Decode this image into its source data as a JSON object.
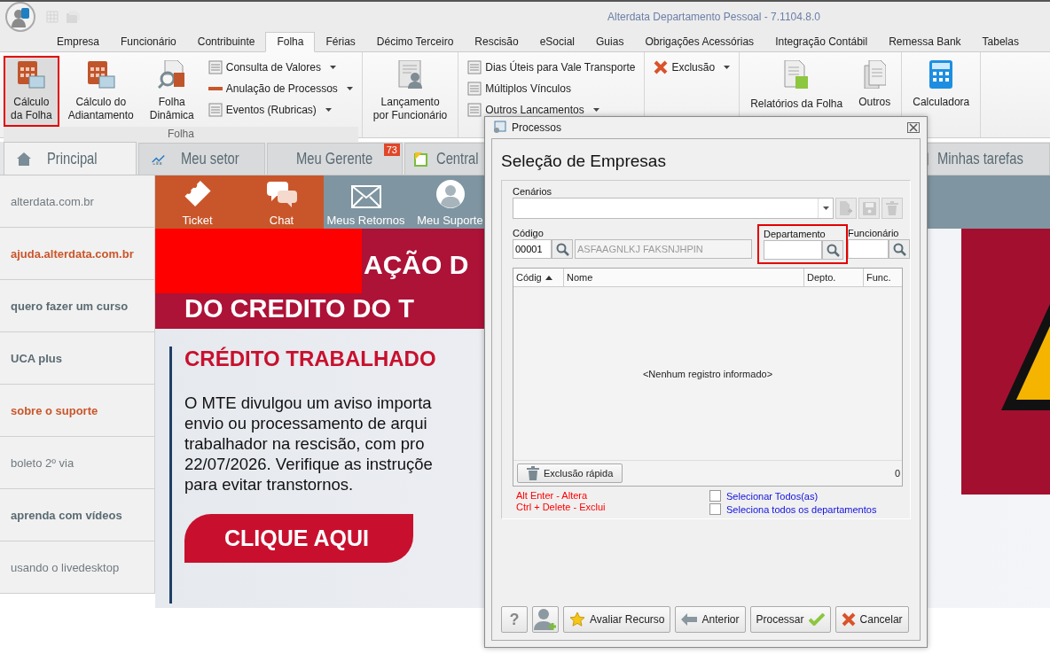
{
  "window": {
    "title": "Alterdata Departamento Pessoal - 7.1104.8.0"
  },
  "ribbon_tabs": [
    {
      "label": "Empresa",
      "selected": false
    },
    {
      "label": "Funcionário",
      "selected": false
    },
    {
      "label": "Contribuinte",
      "selected": false
    },
    {
      "label": "Folha",
      "selected": true
    },
    {
      "label": "Férias",
      "selected": false
    },
    {
      "label": "Décimo Terceiro",
      "selected": false
    },
    {
      "label": "Rescisão",
      "selected": false
    },
    {
      "label": "eSocial",
      "selected": false
    },
    {
      "label": "Guias",
      "selected": false
    },
    {
      "label": "Obrigações Acessórias",
      "selected": false
    },
    {
      "label": "Integração Contábil",
      "selected": false
    },
    {
      "label": "Remessa Bank",
      "selected": false
    },
    {
      "label": "Tabelas",
      "selected": false
    }
  ],
  "ribbon_groups": [
    {
      "label": "Folha",
      "items": [
        {
          "kind": "large",
          "lines": [
            "Cálculo",
            "da Folha"
          ],
          "highlighted": true
        },
        {
          "kind": "large",
          "lines": [
            "Cálculo do",
            "Adiantamento"
          ],
          "highlighted": false
        },
        {
          "kind": "large",
          "lines": [
            "Folha",
            "Dinâmica"
          ],
          "highlighted": false
        },
        {
          "kind": "list",
          "entries": [
            {
              "label": "Consulta de Valores",
              "dropdown": true
            },
            {
              "label": "Anulação de Processos",
              "dropdown": true
            },
            {
              "label": "Eventos (Rubricas)",
              "dropdown": true
            }
          ]
        }
      ]
    },
    {
      "items": [
        {
          "kind": "large",
          "lines": [
            "Lançamento",
            "por Funcionário"
          ],
          "highlighted": false
        }
      ]
    },
    {
      "items": [
        {
          "kind": "list",
          "entries": [
            {
              "label": "Dias Úteis para Vale Transporte",
              "dropdown": false
            },
            {
              "label": "Múltiplos Vínculos",
              "dropdown": false
            },
            {
              "label": "Outros Lancamentos",
              "dropdown": true
            }
          ]
        }
      ]
    },
    {
      "items": [
        {
          "kind": "list",
          "entries": [
            {
              "label": "Exclusão",
              "dropdown": true
            }
          ]
        }
      ]
    },
    {
      "items": [
        {
          "kind": "large",
          "lines": [
            "Relatórios da Folha"
          ],
          "highlighted": false
        },
        {
          "kind": "large",
          "lines": [
            "Outros"
          ],
          "highlighted": false
        }
      ]
    },
    {
      "items": [
        {
          "kind": "large",
          "lines": [
            "Calculadora"
          ],
          "highlighted": false
        }
      ]
    }
  ],
  "home_tabs": [
    {
      "label": "Principal",
      "selected": true
    },
    {
      "label": "Meu setor",
      "selected": false
    },
    {
      "label": "Meu Gerente",
      "selected": false,
      "badge": "73"
    },
    {
      "label": "Central",
      "selected": false
    },
    {
      "label": "Minhas tarefas",
      "selected": false
    }
  ],
  "sidebar": {
    "items": [
      {
        "label": "alterdata.com.br",
        "kind": "plain"
      },
      {
        "label": "ajuda.alterdata.com.br",
        "kind": "accent"
      },
      {
        "label": "quero fazer um curso",
        "kind": "bold"
      },
      {
        "label": "UCA plus",
        "kind": "bold"
      },
      {
        "label": "sobre o suporte",
        "kind": "accent"
      },
      {
        "label": "boleto 2º via",
        "kind": "plain"
      },
      {
        "label": "aprenda com vídeos",
        "kind": "bold"
      },
      {
        "label": "usando o livedesktop",
        "kind": "plain"
      }
    ]
  },
  "shortcuts": [
    {
      "label": "Ticket",
      "color": "#c9562a"
    },
    {
      "label": "Chat",
      "color": "#c9562a"
    },
    {
      "label": "Meus Retornos",
      "color": "#7f95a1"
    },
    {
      "label": "Meu Suporte",
      "color": "#7f95a1"
    }
  ],
  "banner": {
    "headline": [
      "AÇÃO D",
      "DO CREDITO DO T"
    ],
    "title": "CRÉDITO TRABALHADO",
    "body": [
      "O MTE divulgou um aviso importa",
      "envio ou processamento de arqui",
      "trabalhador na rescisão, com pro",
      "22/07/2026. Verifique as instruçõe",
      "para evitar transtornos."
    ],
    "button": "CLIQUE AQUI"
  },
  "dialog": {
    "title": "Processos",
    "heading": "Seleção de Empresas",
    "scenarios": {
      "label": "Cenários"
    },
    "code": {
      "label": "Código",
      "value": "00001",
      "name": "ASFAAGNLKJ FAKSNJHPIN"
    },
    "department": {
      "label": "Departamento",
      "highlighted": true
    },
    "employee": {
      "label": "Funcionário"
    },
    "grid": {
      "columns": [
        {
          "label": "Códig",
          "sorted": true
        },
        {
          "label": "Nome",
          "sorted": false
        },
        {
          "label": "Depto.",
          "sorted": false
        },
        {
          "label": "Func.",
          "sorted": false
        }
      ],
      "empty": "<Nenhum registro informado>",
      "quick_delete": "Exclusão rápida",
      "count": "0"
    },
    "hints": [
      "Alt Enter - Altera",
      "Ctrl + Delete - Exclui"
    ],
    "checks": [
      {
        "label": "Selecionar Todos(as)",
        "checked": false
      },
      {
        "label": "Seleciona todos os departamentos",
        "checked": false
      }
    ],
    "buttons": [
      {
        "kind": "help",
        "label": "?"
      },
      {
        "kind": "adduser"
      },
      {
        "kind": "star",
        "label": "Avaliar Recurso"
      },
      {
        "kind": "back",
        "label": "Anterior"
      },
      {
        "kind": "ok",
        "label": "Processar"
      },
      {
        "kind": "cancel",
        "label": "Cancelar"
      }
    ]
  }
}
